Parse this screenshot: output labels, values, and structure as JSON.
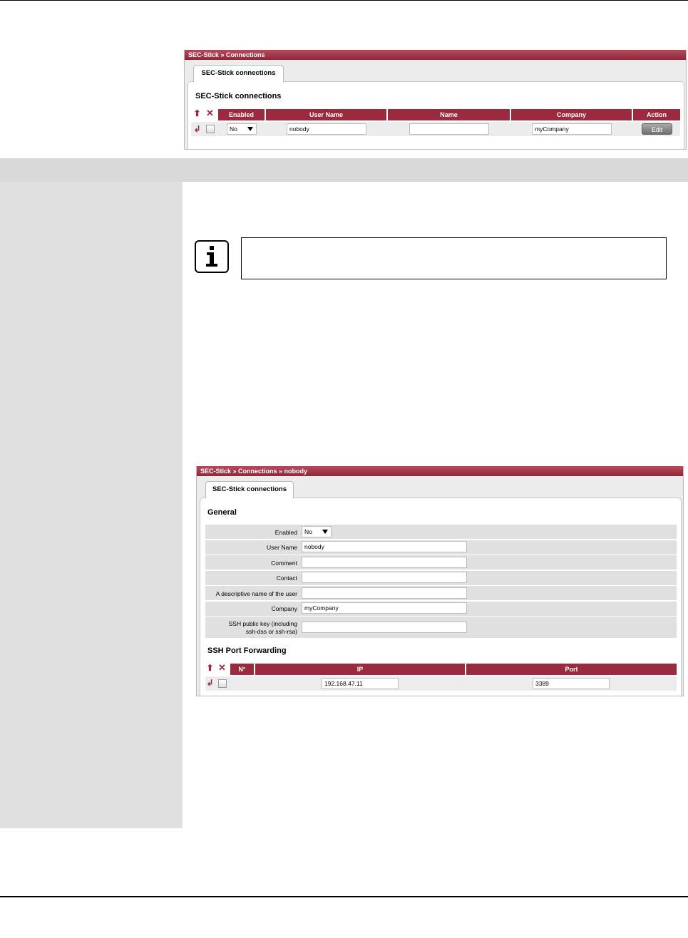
{
  "panel1": {
    "title": "SEC-Stick » Connections",
    "tab": "SEC-Stick connections",
    "section": "SEC-Stick connections",
    "columns": [
      "Enabled",
      "User Name",
      "Name",
      "Company",
      "Action"
    ],
    "row": {
      "enabled": "No",
      "user_name": "nobody",
      "name": "",
      "company": "myCompany",
      "action": "Edit"
    }
  },
  "panel2": {
    "title": "SEC-Stick » Connections » nobody",
    "tab": "SEC-Stick connections",
    "general_title": "General",
    "fields": [
      {
        "label": "Enabled",
        "value": "No"
      },
      {
        "label": "User Name",
        "value": "nobody"
      },
      {
        "label": "Comment",
        "value": ""
      },
      {
        "label": "Contact",
        "value": ""
      },
      {
        "label": "A descriptive name of the user",
        "value": ""
      },
      {
        "label": "Company",
        "value": "myCompany"
      },
      {
        "label": "SSH public key (including",
        "label2": "ssh-dss or ssh-rsa)",
        "value": ""
      }
    ],
    "pf_title": "SSH Port Forwarding",
    "pf_columns": [
      "N°",
      "IP",
      "Port"
    ],
    "pf_row": {
      "ip": "192.168.47.11",
      "port": "3389"
    }
  },
  "icons": [
    "move-icon",
    "delete-icon",
    "insert-row-icon",
    "info-icon",
    "dropdown-arrow-icon"
  ]
}
